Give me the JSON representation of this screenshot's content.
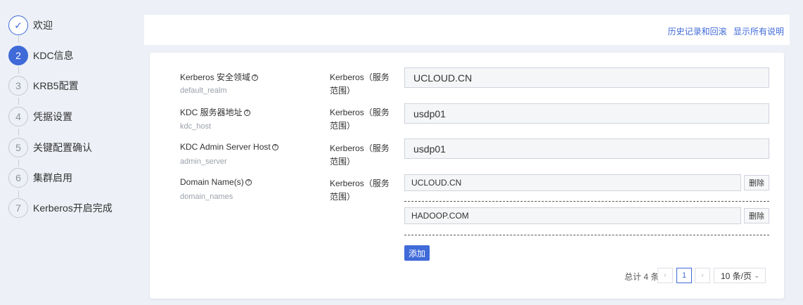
{
  "steps": [
    {
      "num": "✓",
      "label": "欢迎",
      "state": "done"
    },
    {
      "num": "2",
      "label": "KDC信息",
      "state": "active"
    },
    {
      "num": "3",
      "label": "KRB5配置",
      "state": "todo"
    },
    {
      "num": "4",
      "label": "凭据设置",
      "state": "todo"
    },
    {
      "num": "5",
      "label": "关键配置确认",
      "state": "todo"
    },
    {
      "num": "6",
      "label": "集群启用",
      "state": "todo"
    },
    {
      "num": "7",
      "label": "Kerberos开启完成",
      "state": "todo"
    }
  ],
  "topbar": {
    "history_link": "历史记录和回滚",
    "show_all_link": "显示所有说明"
  },
  "help_glyph": "?",
  "rows": [
    {
      "label": "Kerberos 安全领域",
      "key": "default_realm",
      "scope": "Kerberos（服务范围）",
      "value": "UCLOUD.CN"
    },
    {
      "label": "KDC 服务器地址",
      "key": "kdc_host",
      "scope": "Kerberos（服务范围）",
      "value": "usdp01"
    },
    {
      "label": "KDC Admin Server Host",
      "key": "admin_server",
      "scope": "Kerberos（服务范围）",
      "value": "usdp01"
    },
    {
      "label": "Domain Name(s)",
      "key": "domain_names",
      "scope": "Kerberos（服务范围）"
    }
  ],
  "domain_entries": [
    {
      "value": "UCLOUD.CN",
      "delete_label": "删除"
    },
    {
      "value": "HADOOP.COM",
      "delete_label": "删除"
    }
  ],
  "add_button": "添加",
  "pagination": {
    "total": "总计 4 条",
    "prev": "‹",
    "current_page": "1",
    "next": "›",
    "page_size": "10 条/页",
    "size_arrow": "⌄"
  },
  "colors": {
    "accent": "#3f6ad8",
    "background": "#edf0f6"
  }
}
